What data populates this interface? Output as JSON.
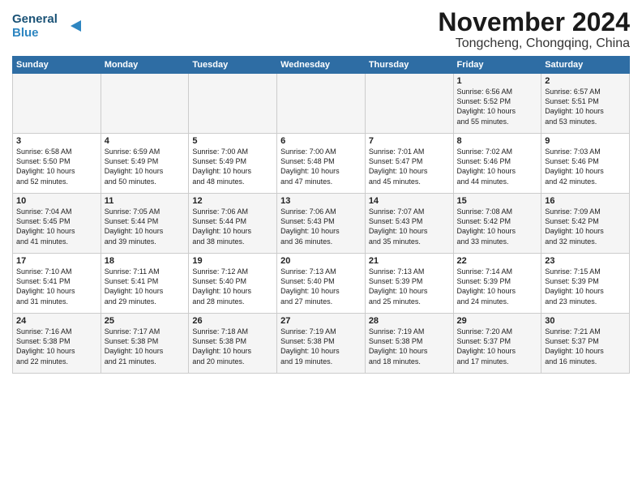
{
  "header": {
    "logo_line1": "General",
    "logo_line2": "Blue",
    "month": "November 2024",
    "location": "Tongcheng, Chongqing, China"
  },
  "columns": [
    "Sunday",
    "Monday",
    "Tuesday",
    "Wednesday",
    "Thursday",
    "Friday",
    "Saturday"
  ],
  "weeks": [
    [
      {
        "day": "",
        "info": ""
      },
      {
        "day": "",
        "info": ""
      },
      {
        "day": "",
        "info": ""
      },
      {
        "day": "",
        "info": ""
      },
      {
        "day": "",
        "info": ""
      },
      {
        "day": "1",
        "info": "Sunrise: 6:56 AM\nSunset: 5:52 PM\nDaylight: 10 hours\nand 55 minutes."
      },
      {
        "day": "2",
        "info": "Sunrise: 6:57 AM\nSunset: 5:51 PM\nDaylight: 10 hours\nand 53 minutes."
      }
    ],
    [
      {
        "day": "3",
        "info": "Sunrise: 6:58 AM\nSunset: 5:50 PM\nDaylight: 10 hours\nand 52 minutes."
      },
      {
        "day": "4",
        "info": "Sunrise: 6:59 AM\nSunset: 5:49 PM\nDaylight: 10 hours\nand 50 minutes."
      },
      {
        "day": "5",
        "info": "Sunrise: 7:00 AM\nSunset: 5:49 PM\nDaylight: 10 hours\nand 48 minutes."
      },
      {
        "day": "6",
        "info": "Sunrise: 7:00 AM\nSunset: 5:48 PM\nDaylight: 10 hours\nand 47 minutes."
      },
      {
        "day": "7",
        "info": "Sunrise: 7:01 AM\nSunset: 5:47 PM\nDaylight: 10 hours\nand 45 minutes."
      },
      {
        "day": "8",
        "info": "Sunrise: 7:02 AM\nSunset: 5:46 PM\nDaylight: 10 hours\nand 44 minutes."
      },
      {
        "day": "9",
        "info": "Sunrise: 7:03 AM\nSunset: 5:46 PM\nDaylight: 10 hours\nand 42 minutes."
      }
    ],
    [
      {
        "day": "10",
        "info": "Sunrise: 7:04 AM\nSunset: 5:45 PM\nDaylight: 10 hours\nand 41 minutes."
      },
      {
        "day": "11",
        "info": "Sunrise: 7:05 AM\nSunset: 5:44 PM\nDaylight: 10 hours\nand 39 minutes."
      },
      {
        "day": "12",
        "info": "Sunrise: 7:06 AM\nSunset: 5:44 PM\nDaylight: 10 hours\nand 38 minutes."
      },
      {
        "day": "13",
        "info": "Sunrise: 7:06 AM\nSunset: 5:43 PM\nDaylight: 10 hours\nand 36 minutes."
      },
      {
        "day": "14",
        "info": "Sunrise: 7:07 AM\nSunset: 5:43 PM\nDaylight: 10 hours\nand 35 minutes."
      },
      {
        "day": "15",
        "info": "Sunrise: 7:08 AM\nSunset: 5:42 PM\nDaylight: 10 hours\nand 33 minutes."
      },
      {
        "day": "16",
        "info": "Sunrise: 7:09 AM\nSunset: 5:42 PM\nDaylight: 10 hours\nand 32 minutes."
      }
    ],
    [
      {
        "day": "17",
        "info": "Sunrise: 7:10 AM\nSunset: 5:41 PM\nDaylight: 10 hours\nand 31 minutes."
      },
      {
        "day": "18",
        "info": "Sunrise: 7:11 AM\nSunset: 5:41 PM\nDaylight: 10 hours\nand 29 minutes."
      },
      {
        "day": "19",
        "info": "Sunrise: 7:12 AM\nSunset: 5:40 PM\nDaylight: 10 hours\nand 28 minutes."
      },
      {
        "day": "20",
        "info": "Sunrise: 7:13 AM\nSunset: 5:40 PM\nDaylight: 10 hours\nand 27 minutes."
      },
      {
        "day": "21",
        "info": "Sunrise: 7:13 AM\nSunset: 5:39 PM\nDaylight: 10 hours\nand 25 minutes."
      },
      {
        "day": "22",
        "info": "Sunrise: 7:14 AM\nSunset: 5:39 PM\nDaylight: 10 hours\nand 24 minutes."
      },
      {
        "day": "23",
        "info": "Sunrise: 7:15 AM\nSunset: 5:39 PM\nDaylight: 10 hours\nand 23 minutes."
      }
    ],
    [
      {
        "day": "24",
        "info": "Sunrise: 7:16 AM\nSunset: 5:38 PM\nDaylight: 10 hours\nand 22 minutes."
      },
      {
        "day": "25",
        "info": "Sunrise: 7:17 AM\nSunset: 5:38 PM\nDaylight: 10 hours\nand 21 minutes."
      },
      {
        "day": "26",
        "info": "Sunrise: 7:18 AM\nSunset: 5:38 PM\nDaylight: 10 hours\nand 20 minutes."
      },
      {
        "day": "27",
        "info": "Sunrise: 7:19 AM\nSunset: 5:38 PM\nDaylight: 10 hours\nand 19 minutes."
      },
      {
        "day": "28",
        "info": "Sunrise: 7:19 AM\nSunset: 5:38 PM\nDaylight: 10 hours\nand 18 minutes."
      },
      {
        "day": "29",
        "info": "Sunrise: 7:20 AM\nSunset: 5:37 PM\nDaylight: 10 hours\nand 17 minutes."
      },
      {
        "day": "30",
        "info": "Sunrise: 7:21 AM\nSunset: 5:37 PM\nDaylight: 10 hours\nand 16 minutes."
      }
    ]
  ]
}
